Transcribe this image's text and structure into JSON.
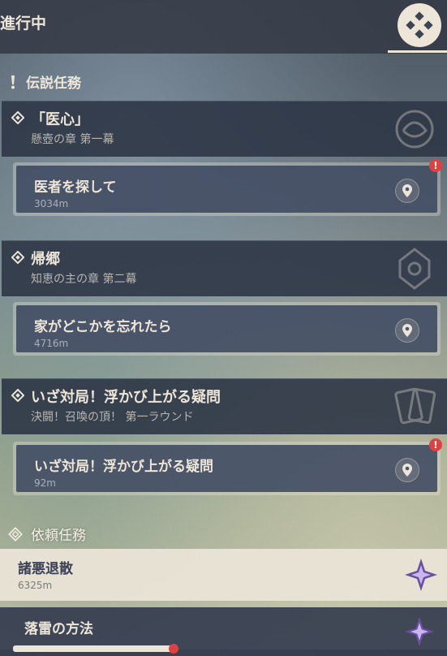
{
  "header": {
    "title": "進行中"
  },
  "legend_section": {
    "label": "伝説任務"
  },
  "quests": [
    {
      "title": "「医心」",
      "subtitle": "懸壺の章 第一幕",
      "subquest": {
        "title": "医者を探して",
        "distance": "3034m",
        "alert": "!"
      }
    },
    {
      "title": "帰郷",
      "subtitle": "知恵の主の章 第二幕",
      "subquest": {
        "title": "家がどこかを忘れたら",
        "distance": "4716m"
      }
    },
    {
      "title": "いざ対局！浮かび上がる疑問",
      "subtitle": "決闘！召喚の頂！ 第一ラウンド",
      "subquest": {
        "title": "いざ対局！浮かび上がる疑問",
        "distance": "92m",
        "alert": "!"
      }
    }
  ],
  "commission_section": {
    "label": "依頼任務"
  },
  "commissions": [
    {
      "title": "諸悪退散",
      "distance": "6325m"
    },
    {
      "title": "落雷の方法"
    }
  ]
}
